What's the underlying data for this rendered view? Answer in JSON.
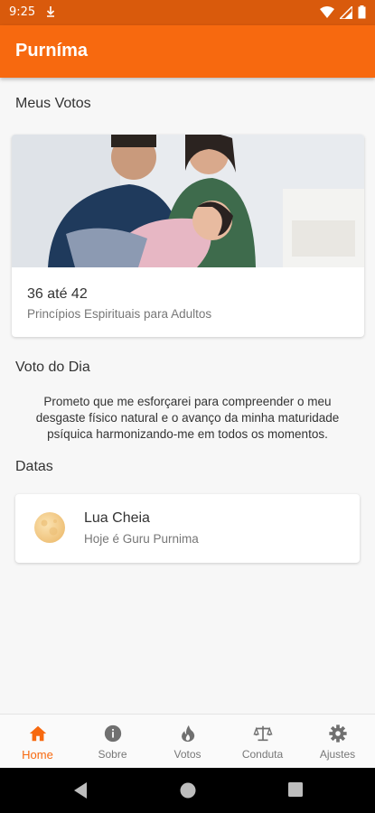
{
  "status_bar": {
    "time": "9:25"
  },
  "app_bar": {
    "title": "Purníma"
  },
  "vows_section": {
    "heading": "Meus Votos",
    "card": {
      "range": "36 até 42",
      "subtitle": "Princípios Espirituais para Adultos"
    }
  },
  "daily_vow": {
    "heading": "Voto do Dia",
    "text": "Prometo que me esforçarei para compreender o meu desgaste físico natural e o avanço da minha maturidade psíquica harmonizando-me em todos os momentos."
  },
  "dates_section": {
    "heading": "Datas",
    "card": {
      "name": "Lua Cheia",
      "description": "Hoje é Guru Purnima"
    }
  },
  "bottom_nav": {
    "items": [
      {
        "label": "Home",
        "icon": "home-icon",
        "active": true
      },
      {
        "label": "Sobre",
        "icon": "info-icon"
      },
      {
        "label": "Votos",
        "icon": "flame-icon"
      },
      {
        "label": "Conduta",
        "icon": "scale-icon"
      },
      {
        "label": "Ajustes",
        "icon": "gear-icon"
      }
    ]
  },
  "colors": {
    "primary": "#f7690f",
    "status_bar": "#d95a0c",
    "inactive": "#777777"
  }
}
